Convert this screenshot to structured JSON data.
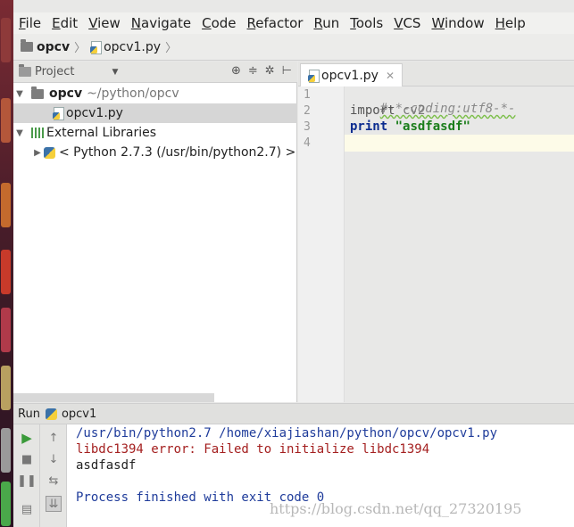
{
  "menu": [
    "File",
    "Edit",
    "View",
    "Navigate",
    "Code",
    "Refactor",
    "Run",
    "Tools",
    "VCS",
    "Window",
    "Help"
  ],
  "breadcrumb": {
    "project": "opcv",
    "file": "opcv1.py"
  },
  "project_panel": {
    "title": "Project",
    "root_name": "opcv",
    "root_path": "~/python/opcv",
    "file": "opcv1.py",
    "external_libraries": "External Libraries",
    "python_sdk": "< Python 2.7.3 (/usr/bin/python2.7) >"
  },
  "editor": {
    "tab": "opcv1.py",
    "line_numbers": [
      "1",
      "2",
      "3",
      "4"
    ],
    "lines": {
      "l1": "#-*-coding:utf8-*-",
      "l2_kw": "import",
      "l2_id": " cv2",
      "l3_kw": "print",
      "l3_str": " \"asdfasdf\""
    }
  },
  "run_panel": {
    "label": "Run",
    "config": "opcv1",
    "output": {
      "cmd": "/usr/bin/python2.7 /home/xiajiashan/python/opcv/opcv1.py",
      "err": "libdc1394 error: Failed to initialize libdc1394",
      "out": "asdfasdf",
      "fin": "Process finished with exit code 0"
    }
  },
  "watermark": "https://blog.csdn.net/qq_27320195"
}
